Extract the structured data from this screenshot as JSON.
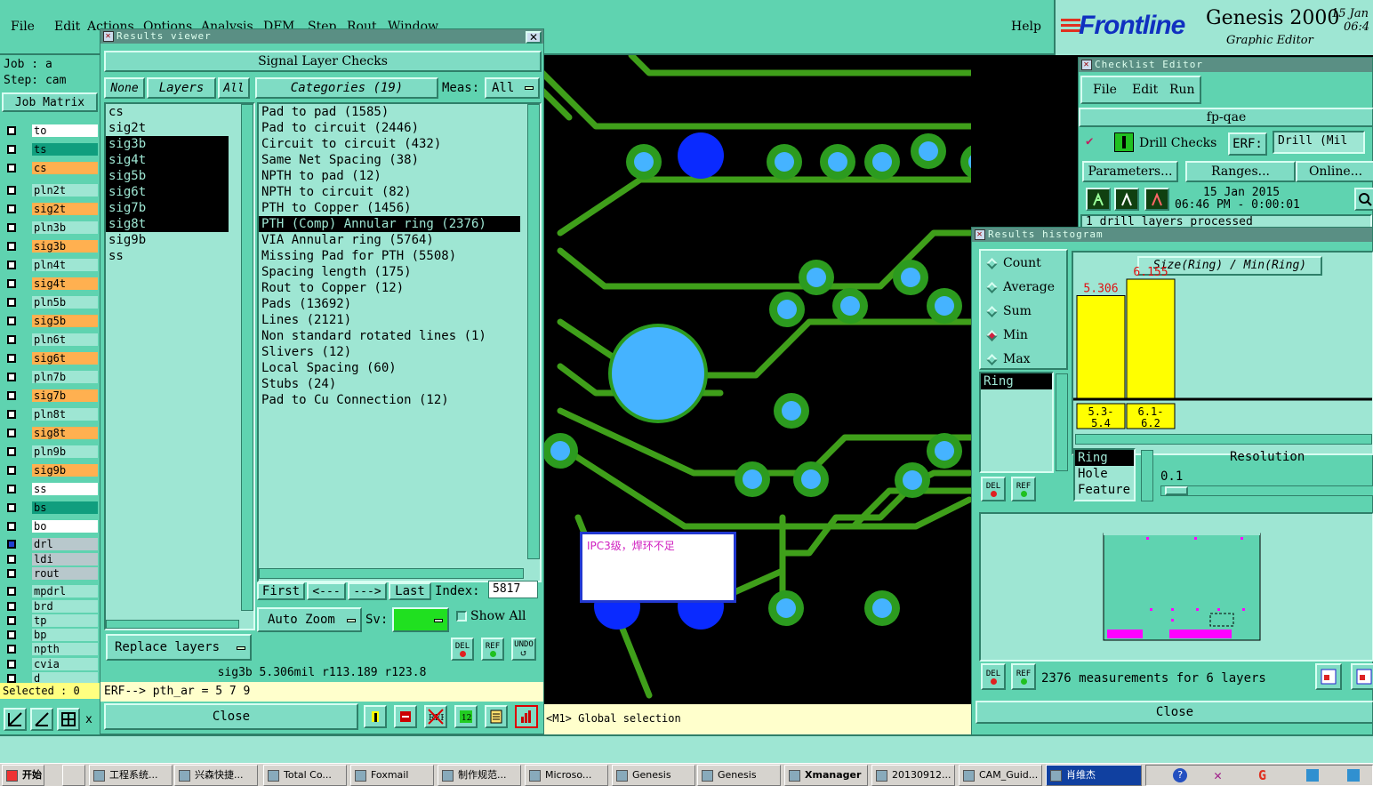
{
  "menubar": {
    "items": [
      "File",
      "Edit",
      "Actions",
      "Options",
      "Analysis",
      "DFM",
      "Step",
      "Rout",
      "Window"
    ],
    "help": "Help"
  },
  "brand": {
    "logo": "Frontline",
    "product": "Genesis 2000",
    "subtitle": "Graphic Editor",
    "date": "15 Jan",
    "time": "06:4"
  },
  "job": {
    "job_label": "Job : a",
    "step_label": "Step: cam",
    "job_matrix": "Job Matrix",
    "selected": "Selected : 0"
  },
  "layers": [
    {
      "name": "to",
      "color": "#ffffff"
    },
    {
      "name": "ts",
      "color": "#109e7e"
    },
    {
      "name": "cs",
      "color": "#ffb050"
    },
    {
      "name": "pln2t",
      "color": "#9ee6d3"
    },
    {
      "name": "sig2t",
      "color": "#ffb050"
    },
    {
      "name": "pln3b",
      "color": "#9ee6d3"
    },
    {
      "name": "sig3b",
      "color": "#ffb050"
    },
    {
      "name": "pln4t",
      "color": "#9ee6d3"
    },
    {
      "name": "sig4t",
      "color": "#ffb050"
    },
    {
      "name": "pln5b",
      "color": "#9ee6d3"
    },
    {
      "name": "sig5b",
      "color": "#ffb050"
    },
    {
      "name": "pln6t",
      "color": "#9ee6d3"
    },
    {
      "name": "sig6t",
      "color": "#ffb050"
    },
    {
      "name": "pln7b",
      "color": "#9ee6d3"
    },
    {
      "name": "sig7b",
      "color": "#ffb050"
    },
    {
      "name": "pln8t",
      "color": "#9ee6d3"
    },
    {
      "name": "sig8t",
      "color": "#ffb050"
    },
    {
      "name": "pln9b",
      "color": "#9ee6d3"
    },
    {
      "name": "sig9b",
      "color": "#ffb050"
    },
    {
      "name": "ss",
      "color": "#ffffff"
    },
    {
      "name": "bs",
      "color": "#109e7e"
    },
    {
      "name": "bo",
      "color": "#ffffff"
    },
    {
      "name": "drl",
      "color": "#b8c8cc"
    },
    {
      "name": "ldi",
      "color": "#b8c8cc"
    },
    {
      "name": "rout",
      "color": "#b8c8cc"
    },
    {
      "name": "mpdrl",
      "color": "#9ee6d3"
    },
    {
      "name": "brd",
      "color": "#9ee6d3"
    },
    {
      "name": "tp",
      "color": "#9ee6d3"
    },
    {
      "name": "bp",
      "color": "#9ee6d3"
    },
    {
      "name": "npth",
      "color": "#9ee6d3"
    },
    {
      "name": "cvia",
      "color": "#9ee6d3"
    },
    {
      "name": "d",
      "color": "#9ee6d3"
    }
  ],
  "results_viewer": {
    "title": "Results viewer",
    "header": "Signal Layer Checks",
    "none_btn": "None",
    "layers_btn": "Layers",
    "all_btn": "All",
    "categories_btn": "Categories (19)",
    "meas_label": "Meas:",
    "meas_value": "All",
    "layer_list": [
      "cs",
      "sig2t",
      "sig3b",
      "sig4t",
      "sig5b",
      "sig6t",
      "sig7b",
      "sig8t",
      "sig9b",
      "ss"
    ],
    "layer_selected": [
      2,
      3,
      4,
      5,
      6,
      7
    ],
    "categories": [
      "Pad to pad (1585)",
      "Pad to circuit (2446)",
      "Circuit to circuit (432)",
      "Same Net Spacing (38)",
      "NPTH to pad (12)",
      "NPTH to circuit (82)",
      "PTH to Copper (1456)",
      "PTH (Comp) Annular ring (2376)",
      "VIA Annular ring (5764)",
      "Missing Pad for PTH (5508)",
      "Spacing length (175)",
      "Rout to Copper (12)",
      "Pads (13692)",
      "Lines (2121)",
      "Non standard rotated lines (1)",
      "Slivers (12)",
      "Local Spacing (60)",
      "Stubs (24)",
      "Pad to Cu Connection (12)"
    ],
    "category_selected": 7,
    "first": "First",
    "prev": "<---",
    "next": "--->",
    "last": "Last",
    "index_label": "Index:",
    "index_value": "5817",
    "auto_zoom": "Auto Zoom",
    "sv_label": "Sv:",
    "show_all": "Show All",
    "del": "DEL",
    "ref": "REF",
    "undo": "UNDO",
    "replace_layers": "Replace layers",
    "status": "sig3b 5.306mil  r113.189  r123.8",
    "erf": "ERF--> pth_ar = 5 7 9",
    "close": "Close"
  },
  "canvas": {
    "note": "IPC3级，焊环不足",
    "status": "<M1> Global selection"
  },
  "checklist": {
    "title": "Checklist Editor",
    "menu": [
      "File",
      "Edit",
      "Run"
    ],
    "name": "fp-qae",
    "check": "Drill Checks",
    "erf_label": "ERF:",
    "erf_value": "Drill (Mil",
    "parameters": "Parameters...",
    "ranges": "Ranges...",
    "online": "Online...",
    "date": "15 Jan 2015",
    "time": "06:46 PM - 0:00:01",
    "log": "1 drill layers processed"
  },
  "histogram": {
    "title": "Results histogram",
    "modes": [
      "Count",
      "Average",
      "Sum",
      "Min",
      "Max"
    ],
    "mode_selected": 3,
    "list": [
      "Ring"
    ],
    "chart_title": "Size(Ring) / Min(Ring)",
    "resolution_label": "Resolution",
    "resolution_value": "0.1",
    "measures": [
      "Ring",
      "Hole",
      "Feature"
    ],
    "summary": "2376 measurements for 6 layers",
    "del": "DEL",
    "ref": "REF",
    "close": "Close"
  },
  "chart_data": {
    "type": "bar",
    "categories": [
      "5.3-5.4",
      "6.1-6.2"
    ],
    "values": [
      5.306,
      6.155
    ],
    "title": "Size(Ring) / Min(Ring)",
    "xlabel": "",
    "ylabel": ""
  },
  "taskbar": {
    "start": "开始",
    "items": [
      "工程系统...",
      "兴森快捷...",
      "Total Co...",
      "Foxmail",
      "制作规范...",
      "Microso...",
      "Genesis",
      "Genesis",
      "Xmanager",
      "20130912...",
      "CAM_Guid...",
      "肖维杰"
    ]
  },
  "colors": {
    "panel": "#5fd3b0",
    "canvas": "#000000",
    "trace": "#3f9f1a",
    "pad_ring": "#2c9b1f",
    "pad_center": "#45b3ff",
    "bar": "#ffff00"
  }
}
